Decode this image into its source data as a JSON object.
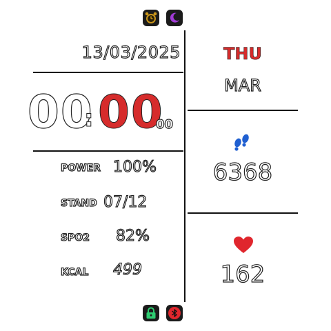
{
  "date": "13/03/2025",
  "day": "THU",
  "month": "MAR",
  "time": {
    "hours": "00",
    "minutes": "00",
    "seconds": "00",
    "separator": ":"
  },
  "stats": [
    {
      "label": "POWER",
      "value": "100%"
    },
    {
      "label": "STAND",
      "value": "07/12"
    },
    {
      "label": "SPO2",
      "value": "82%"
    },
    {
      "label": "KCAL",
      "value": "499"
    }
  ],
  "steps": "6368",
  "heart_rate": "162",
  "icons": {
    "top": [
      "alarm-icon",
      "moon-icon"
    ],
    "bottom": [
      "lock-icon",
      "bluetooth-icon"
    ],
    "steps": "footprints-icon",
    "heart": "heart-icon"
  },
  "colors": {
    "accent_red": "#d62c2c",
    "steps_blue": "#1f5fd1",
    "alarm": "#c9951a",
    "moon": "#a13bd6",
    "lock": "#2ecc71",
    "bluetooth": "#e0262d"
  }
}
